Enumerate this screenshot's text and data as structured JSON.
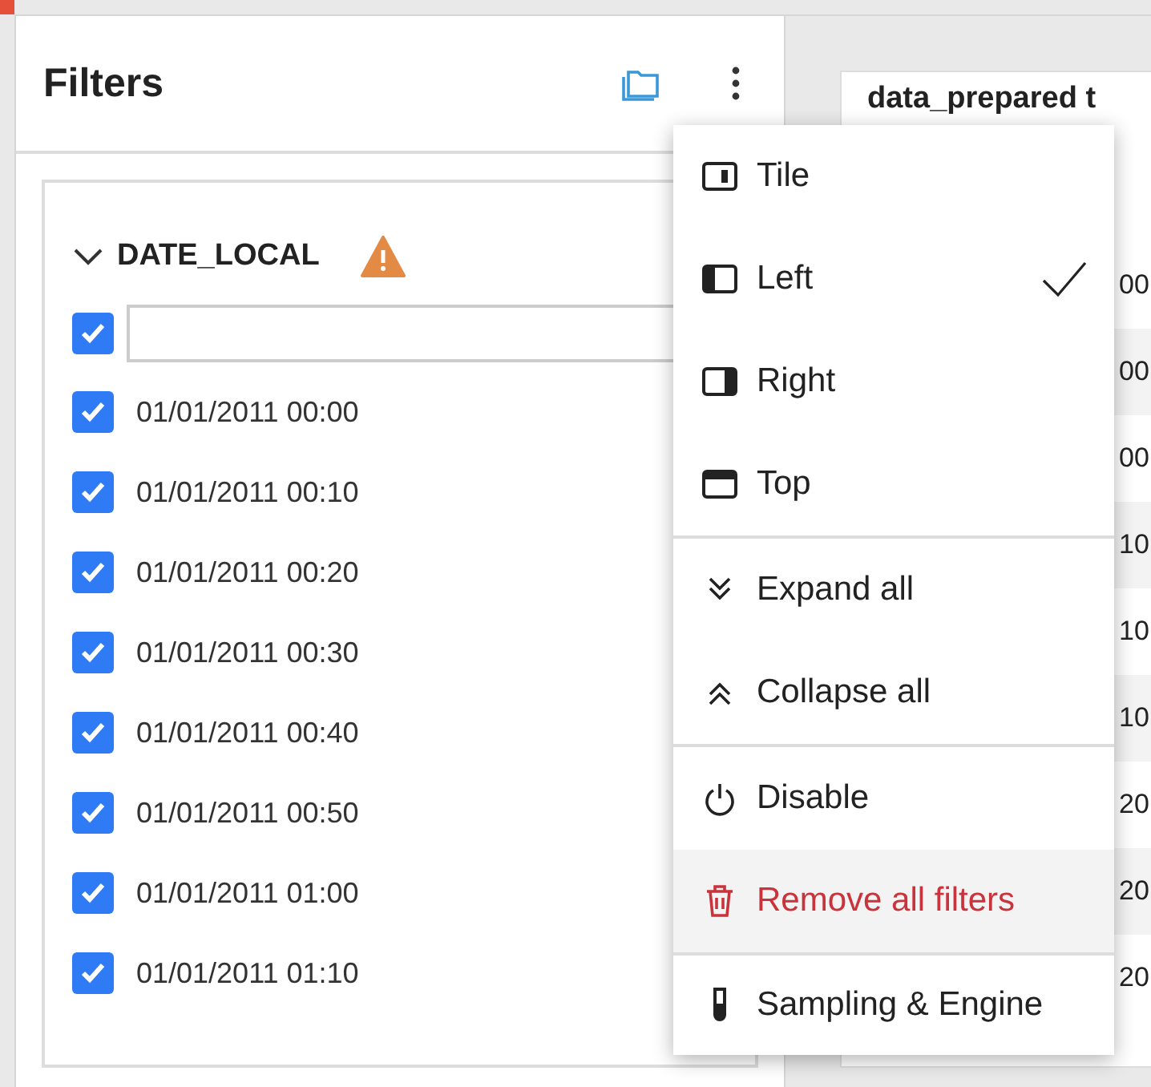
{
  "panel": {
    "title": "Filters"
  },
  "filter": {
    "name": "DATE_LOCAL",
    "expanded": true,
    "warning": true,
    "select_all": {
      "checked": true
    },
    "values": [
      {
        "label": "01/01/2011 00:00",
        "checked": true
      },
      {
        "label": "01/01/2011 00:10",
        "checked": true
      },
      {
        "label": "01/01/2011 00:20",
        "checked": true
      },
      {
        "label": "01/01/2011 00:30",
        "checked": true
      },
      {
        "label": "01/01/2011 00:40",
        "checked": true
      },
      {
        "label": "01/01/2011 00:50",
        "checked": true
      },
      {
        "label": "01/01/2011 01:00",
        "checked": true
      },
      {
        "label": "01/01/2011 01:10",
        "checked": true
      }
    ]
  },
  "dataset": {
    "title": "data_prepared t",
    "cells": [
      "00",
      "00",
      "00",
      "10",
      "10",
      "10",
      "20",
      "20",
      "20"
    ]
  },
  "menu": {
    "sections": [
      [
        {
          "label": "Tile",
          "checked": false,
          "highlighted": false,
          "danger": false
        },
        {
          "label": "Left",
          "checked": true,
          "highlighted": false,
          "danger": false
        },
        {
          "label": "Right",
          "checked": false,
          "highlighted": false,
          "danger": false
        },
        {
          "label": "Top",
          "checked": false,
          "highlighted": false,
          "danger": false
        }
      ],
      [
        {
          "label": "Expand all",
          "checked": false,
          "highlighted": false,
          "danger": false
        },
        {
          "label": "Collapse all",
          "checked": false,
          "highlighted": false,
          "danger": false
        }
      ],
      [
        {
          "label": "Disable",
          "checked": false,
          "highlighted": false,
          "danger": false
        },
        {
          "label": "Remove all filters",
          "checked": false,
          "highlighted": true,
          "danger": true
        }
      ],
      [
        {
          "label": "Sampling & Engine",
          "checked": false,
          "highlighted": false,
          "danger": false
        }
      ]
    ]
  }
}
